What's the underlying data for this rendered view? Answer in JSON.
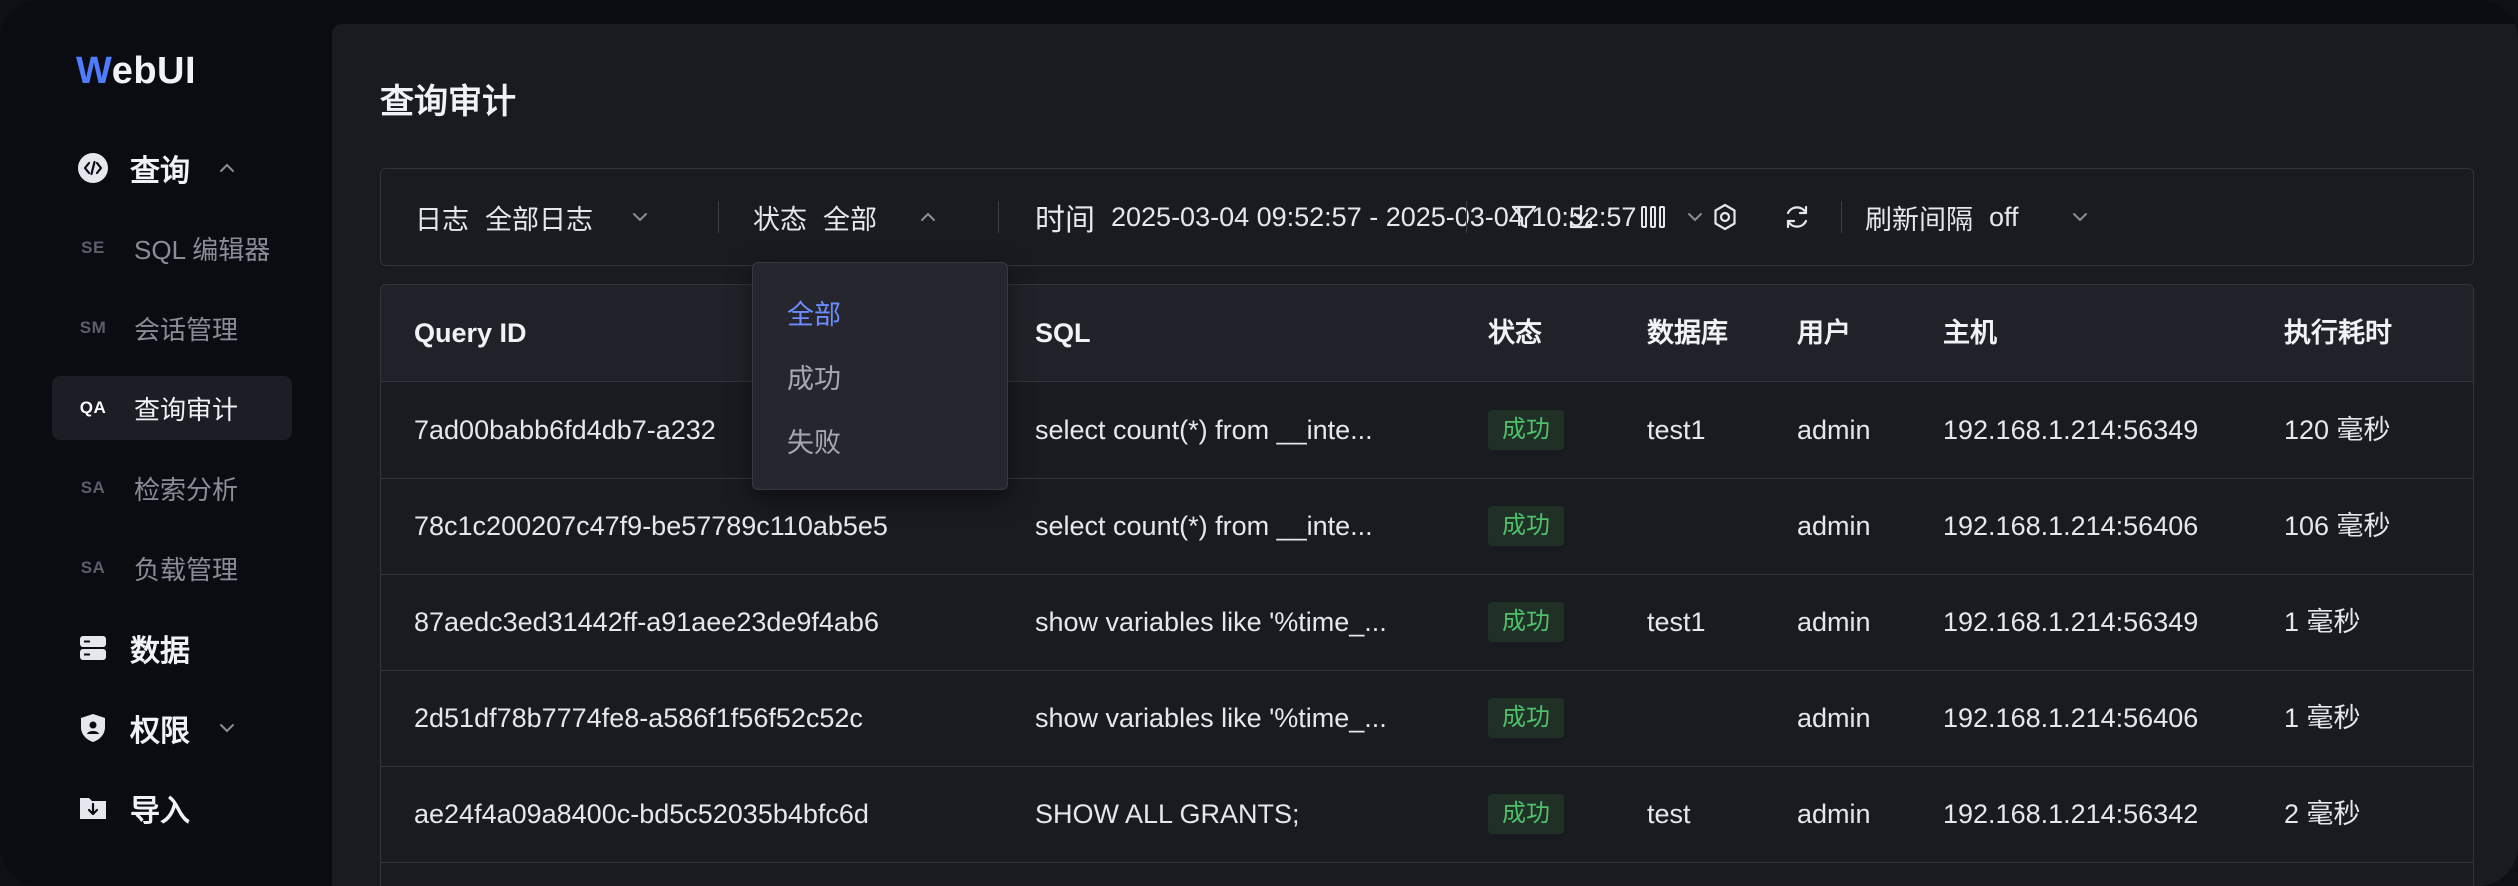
{
  "brand": {
    "logo_first": "W",
    "logo_rest": "ebUI"
  },
  "sidebar": {
    "query_group": "查询",
    "items": [
      {
        "abbr": "SE",
        "label": "SQL 编辑器"
      },
      {
        "abbr": "SM",
        "label": "会话管理"
      },
      {
        "abbr": "QA",
        "label": "查询审计"
      },
      {
        "abbr": "SA",
        "label": "检索分析"
      },
      {
        "abbr": "SA",
        "label": "负载管理"
      }
    ],
    "data_group": "数据",
    "perm_group": "权限",
    "import_group": "导入"
  },
  "page": {
    "title": "查询审计"
  },
  "filters": {
    "log_label": "日志",
    "log_value": "全部日志",
    "status_label": "状态",
    "status_value": "全部",
    "time_label": "时间",
    "time_value": "2025-03-04 09:52:57 - 2025-03-04 10:52:57",
    "refresh_label": "刷新间隔",
    "refresh_value": "off"
  },
  "status_dropdown": {
    "options": [
      "全部",
      "成功",
      "失败"
    ],
    "selected": "全部"
  },
  "table": {
    "headers": {
      "query_id": "Query ID",
      "sql": "SQL",
      "status": "状态",
      "database": "数据库",
      "user": "用户",
      "host": "主机",
      "duration": "执行耗时"
    },
    "rows": [
      {
        "query_id": "7ad00babb6fd4db7-a232",
        "sql": "select count(*) from __inte...",
        "status": "成功",
        "database": "test1",
        "user": "admin",
        "host": "192.168.1.214:56349",
        "duration": "120 毫秒"
      },
      {
        "query_id": "78c1c200207c47f9-be57789c110ab5e5",
        "sql": "select count(*) from __inte...",
        "status": "成功",
        "database": "",
        "user": "admin",
        "host": "192.168.1.214:56406",
        "duration": "106 毫秒"
      },
      {
        "query_id": "87aedc3ed31442ff-a91aee23de9f4ab6",
        "sql": "show variables like '%time_...",
        "status": "成功",
        "database": "test1",
        "user": "admin",
        "host": "192.168.1.214:56349",
        "duration": "1 毫秒"
      },
      {
        "query_id": "2d51df78b7774fe8-a586f1f56f52c52c",
        "sql": "show variables like '%time_...",
        "status": "成功",
        "database": "",
        "user": "admin",
        "host": "192.168.1.214:56406",
        "duration": "1 毫秒"
      },
      {
        "query_id": "ae24f4a09a8400c-bd5c52035b4bfc6d",
        "sql": "SHOW ALL GRANTS;",
        "status": "成功",
        "database": "test",
        "user": "admin",
        "host": "192.168.1.214:56342",
        "duration": "2 毫秒"
      }
    ]
  },
  "colors": {
    "accent": "#4f7cff",
    "success": "#4fc06c",
    "bg": "#1a1b21"
  }
}
